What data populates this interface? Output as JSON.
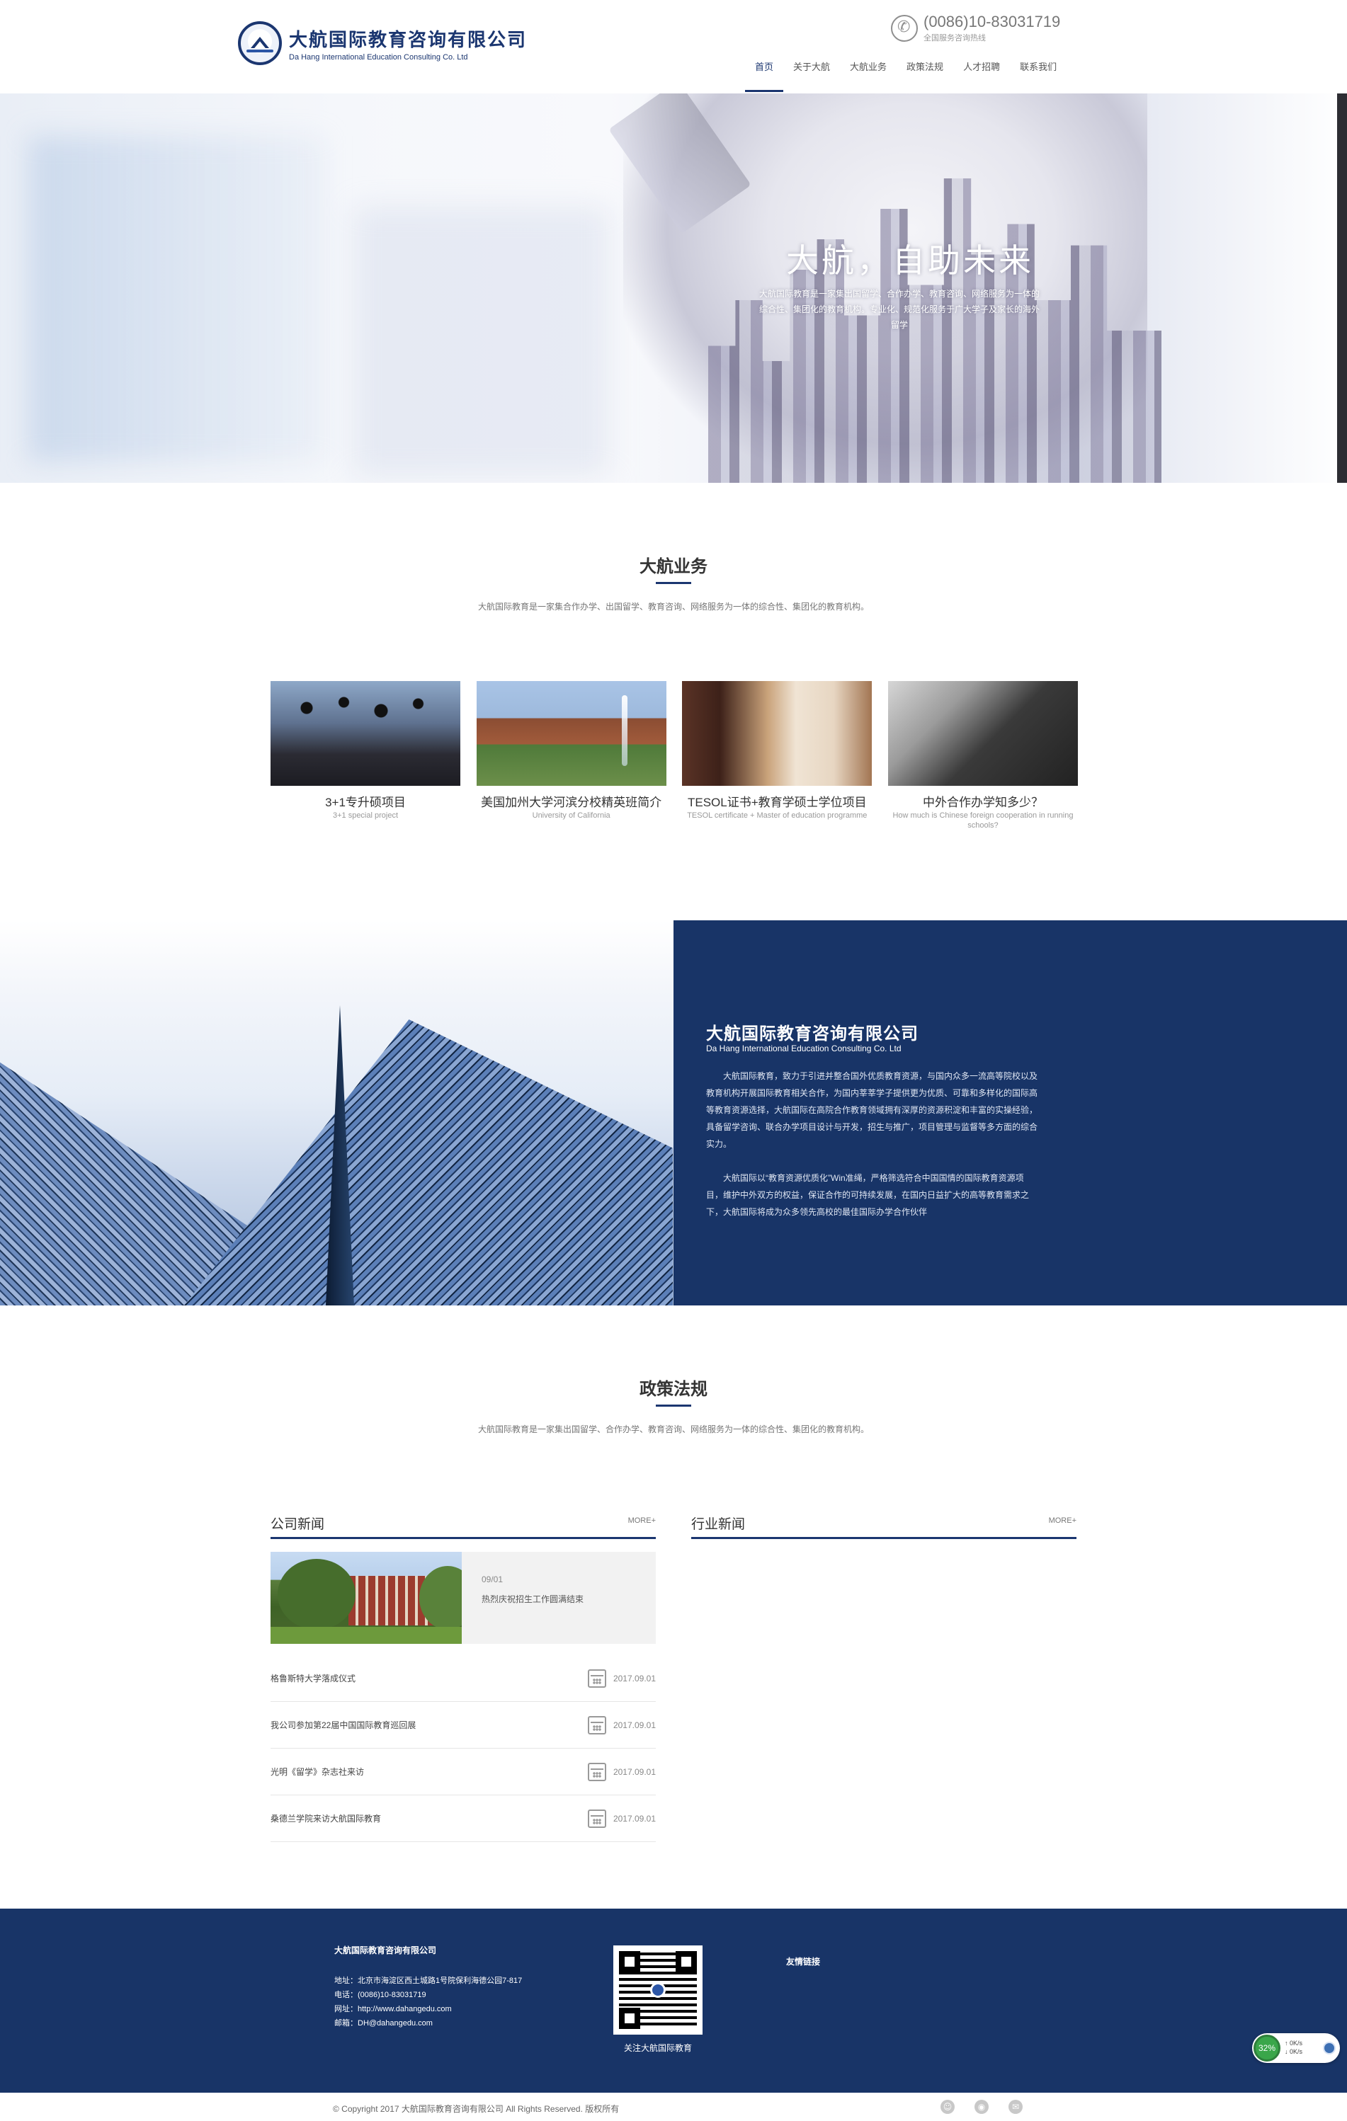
{
  "header": {
    "logo": {
      "cn": "大航国际教育咨询有限公司",
      "en": "Da Hang International Education Consulting Co. Ltd"
    },
    "phone": {
      "number": "(0086)10-83031719",
      "label": "全国服务咨询热线"
    },
    "nav": [
      {
        "label": "首页",
        "active": true
      },
      {
        "label": "关于大航"
      },
      {
        "label": "大航业务"
      },
      {
        "label": "政策法规"
      },
      {
        "label": "人才招聘"
      },
      {
        "label": "联系我们"
      }
    ]
  },
  "banner": {
    "title": "大航，自助未来",
    "desc": "大航国际教育是一家集出国留学、合作办学、教育咨询、网络服务为一体的综合性、集团化的教育机构。专业化、规范化服务于广大学子及家长的海外留学"
  },
  "business": {
    "title": "大航业务",
    "subtitle": "大航国际教育是一家集合作办学、出国留学、教育咨询、网络服务为一体的综合性、集团化的教育机构。",
    "cards": [
      {
        "title": "3+1专升硕项目",
        "sub": "3+1 special project"
      },
      {
        "title": "美国加州大学河滨分校精英班简介",
        "sub": "University of California"
      },
      {
        "title": "TESOL证书+教育学硕士学位项目",
        "sub": "TESOL certificate + Master of education programme"
      },
      {
        "title": "中外合作办学知多少？",
        "sub": "How much is Chinese foreign cooperation in running schools?"
      }
    ]
  },
  "about": {
    "title": "大航国际教育咨询有限公司",
    "en": "Da Hang International Education Consulting Co. Ltd",
    "p1": "大航国际教育，致力于引进并整合国外优质教育资源，与国内众多一流高等院校以及教育机构开展国际教育相关合作，为国内莘莘学子提供更为优质、可靠和多样化的国际高等教育资源选择，大航国际在高院合作教育领域拥有深厚的资源积淀和丰富的实操经验，具备留学咨询、联合办学项目设计与开发，招生与推广，项目管理与监督等多方面的综合实力。",
    "p2": "大航国际以“教育资源优质化”Win准绳，严格筛选符合中国国情的国际教育资源项目，维护中外双方的权益，保证合作的可持续发展，在国内日益扩大的高等教育需求之下，大航国际将成为众多领先高校的最佳国际办学合作伙伴"
  },
  "policy": {
    "title": "政策法规",
    "subtitle": "大航国际教育是一家集出国留学、合作办学、教育咨询、网络服务为一体的综合性、集团化的教育机构。"
  },
  "news": {
    "company": {
      "title": "公司新闻",
      "more": "MORE+",
      "featured": {
        "date": "09/01",
        "title": "热烈庆祝招生工作圆满结束"
      },
      "items": [
        {
          "title": "格鲁斯特大学落成仪式",
          "date": "2017.09.01"
        },
        {
          "title": "我公司参加第22届中国国际教育巡回展",
          "date": "2017.09.01"
        },
        {
          "title": "光明《留学》杂志社来访",
          "date": "2017.09.01"
        },
        {
          "title": "桑德兰学院来访大航国际教育",
          "date": "2017.09.01"
        }
      ]
    },
    "industry": {
      "title": "行业新闻",
      "more": "MORE+"
    }
  },
  "footer": {
    "company": "大航国际教育咨询有限公司",
    "address": "地址：北京市海淀区西土城路1号院保利海德公园7-817",
    "phone": "电话：(0086)10-83031719",
    "web": "网址：http://www.dahangedu.com",
    "email": "邮箱：DH@dahangedu.com",
    "qr_caption": "关注大航国际教育",
    "links_title": "友情链接",
    "copyright": "© Copyright 2017 大航国际教育咨询有限公司 All Rights Reserved. 版权所有"
  },
  "speed_widget": {
    "percent": "32%",
    "up": "0K/s",
    "down": "0K/s"
  }
}
